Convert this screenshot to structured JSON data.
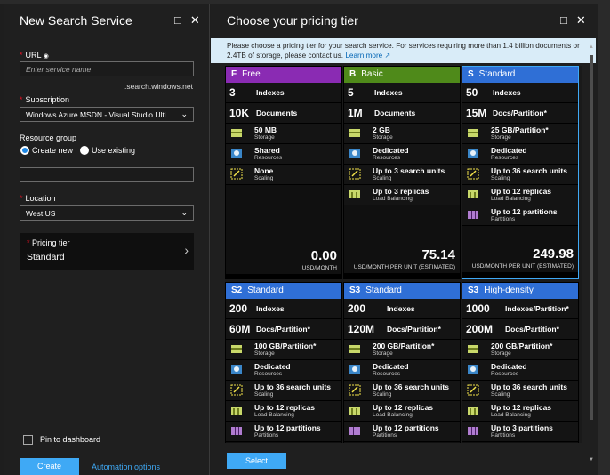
{
  "left_blade": {
    "title": "New Search Service",
    "url_label": "URL",
    "url_placeholder": "Enter service name",
    "url_suffix": ".search.windows.net",
    "subscription_label": "Subscription",
    "subscription_value": "Windows Azure MSDN - Visual Studio Ulti...",
    "resource_group_label": "Resource group",
    "rg_create_new": "Create new",
    "rg_use_existing": "Use existing",
    "location_label": "Location",
    "location_value": "West US",
    "pricing_tier_label": "Pricing tier",
    "pricing_tier_value": "Standard",
    "pin_label": "Pin to dashboard",
    "create_label": "Create",
    "automation_label": "Automation options"
  },
  "right_blade": {
    "title": "Choose your pricing tier",
    "info_text": "Please choose a pricing tier for your search service. For services requiring more than 1.4 billion documents or 2.4TB of storage, please contact us.",
    "learn_more": "Learn more",
    "select_label": "Select"
  },
  "tiers": [
    {
      "code": "F",
      "name": "Free",
      "color": "#8a2bb3",
      "selected": false,
      "n1": "3",
      "n1_label": "Indexes",
      "n2": "10K",
      "n2_label": "Documents",
      "features": [
        {
          "icon": "storage-icon",
          "t": "50 MB",
          "s": "Storage"
        },
        {
          "icon": "shared-resources-icon",
          "t": "Shared",
          "s": "Resources"
        },
        {
          "icon": "scaling-icon",
          "t": "None",
          "s": "Scaling"
        }
      ],
      "price": "0.00",
      "price_label": "USD/MONTH"
    },
    {
      "code": "B",
      "name": "Basic",
      "color": "#4f8a1a",
      "selected": false,
      "n1": "5",
      "n1_label": "Indexes",
      "n2": "1M",
      "n2_label": "Documents",
      "features": [
        {
          "icon": "storage-icon",
          "t": "2 GB",
          "s": "Storage"
        },
        {
          "icon": "dedicated-resources-icon",
          "t": "Dedicated",
          "s": "Resources"
        },
        {
          "icon": "scaling-icon",
          "t": "Up to 3 search units",
          "s": "Scaling"
        },
        {
          "icon": "load-balancing-icon",
          "t": "Up to 3 replicas",
          "s": "Load Balancing"
        }
      ],
      "price": "75.14",
      "price_label": "USD/MONTH PER UNIT (ESTIMATED)"
    },
    {
      "code": "S",
      "name": "Standard",
      "color": "#2f6fd6",
      "selected": true,
      "n1": "50",
      "n1_label": "Indexes",
      "n2": "15M",
      "n2_label": "Docs/Partition*",
      "features": [
        {
          "icon": "storage-icon",
          "t": "25 GB/Partition*",
          "s": "Storage"
        },
        {
          "icon": "dedicated-resources-icon",
          "t": "Dedicated",
          "s": "Resources"
        },
        {
          "icon": "scaling-icon",
          "t": "Up to 36 search units",
          "s": "Scaling"
        },
        {
          "icon": "load-balancing-icon",
          "t": "Up to 12 replicas",
          "s": "Load Balancing"
        },
        {
          "icon": "partitions-icon",
          "t": "Up to 12 partitions",
          "s": "Partitions"
        }
      ],
      "price": "249.98",
      "price_label": "USD/MONTH PER UNIT (ESTIMATED)"
    },
    {
      "code": "S2",
      "name": "Standard",
      "color": "#2f6fd6",
      "selected": false,
      "n1": "200",
      "n1_label": "Indexes",
      "n2": "60M",
      "n2_label": "Docs/Partition*",
      "features": [
        {
          "icon": "storage-icon",
          "t": "100 GB/Partition*",
          "s": "Storage"
        },
        {
          "icon": "dedicated-resources-icon",
          "t": "Dedicated",
          "s": "Resources"
        },
        {
          "icon": "scaling-icon",
          "t": "Up to 36 search units",
          "s": "Scaling"
        },
        {
          "icon": "load-balancing-icon",
          "t": "Up to 12 replicas",
          "s": "Load Balancing"
        },
        {
          "icon": "partitions-icon",
          "t": "Up to 12 partitions",
          "s": "Partitions"
        }
      ],
      "price": "",
      "price_label": ""
    },
    {
      "code": "S3",
      "name": "Standard",
      "color": "#2f6fd6",
      "selected": false,
      "n1": "200",
      "n1_label": "Indexes",
      "n2": "120M",
      "n2_label": "Docs/Partition*",
      "features": [
        {
          "icon": "storage-icon",
          "t": "200 GB/Partition*",
          "s": "Storage"
        },
        {
          "icon": "dedicated-resources-icon",
          "t": "Dedicated",
          "s": "Resources"
        },
        {
          "icon": "scaling-icon",
          "t": "Up to 36 search units",
          "s": "Scaling"
        },
        {
          "icon": "load-balancing-icon",
          "t": "Up to 12 replicas",
          "s": "Load Balancing"
        },
        {
          "icon": "partitions-icon",
          "t": "Up to 12 partitions",
          "s": "Partitions"
        }
      ],
      "price": "",
      "price_label": ""
    },
    {
      "code": "S3",
      "name": "High-density",
      "color": "#2f6fd6",
      "selected": false,
      "n1": "1000",
      "n1_label": "Indexes/Partition*",
      "n2": "200M",
      "n2_label": "Docs/Partition*",
      "features": [
        {
          "icon": "storage-icon",
          "t": "200 GB/Partition*",
          "s": "Storage"
        },
        {
          "icon": "dedicated-resources-icon",
          "t": "Dedicated",
          "s": "Resources"
        },
        {
          "icon": "scaling-icon",
          "t": "Up to 36 search units",
          "s": "Scaling"
        },
        {
          "icon": "load-balancing-icon",
          "t": "Up to 12 replicas",
          "s": "Load Balancing"
        },
        {
          "icon": "partitions-icon",
          "t": "Up to 3 partitions",
          "s": "Partitions"
        }
      ],
      "price": "",
      "price_label": ""
    }
  ]
}
